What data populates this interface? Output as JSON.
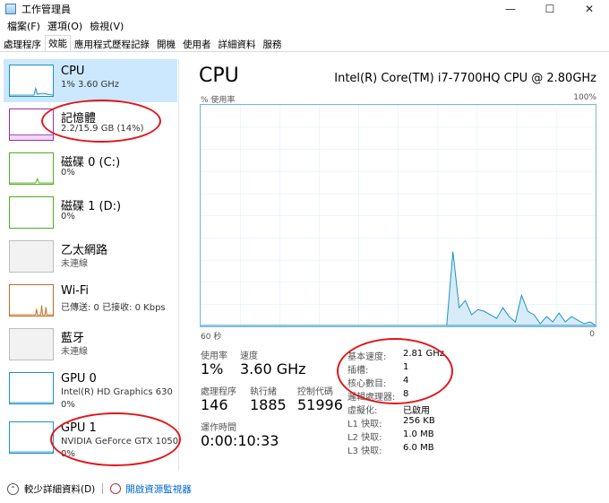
{
  "window": {
    "title": "工作管理員",
    "minimize": "—",
    "maximize": "☐",
    "close": "✕"
  },
  "menu": [
    "檔案(F)",
    "選項(O)",
    "檢視(V)"
  ],
  "tabs": [
    "處理程序",
    "效能",
    "應用程式歷程記錄",
    "開機",
    "使用者",
    "詳細資料",
    "服務"
  ],
  "sidebar": [
    {
      "name": "CPU",
      "sub": "1% 3.60 GHz",
      "color": "#1e90c8"
    },
    {
      "name": "記憶體",
      "sub": "2.2/15.9 GB (14%)",
      "color": "#9b2fae"
    },
    {
      "name": "磁碟 0 (C:)",
      "sub": "0%",
      "color": "#4caf1f"
    },
    {
      "name": "磁碟 1 (D:)",
      "sub": "0%",
      "color": "#4caf1f"
    },
    {
      "name": "乙太網路",
      "sub": "未連線",
      "color": "#9a9a9a"
    },
    {
      "name": "Wi-Fi",
      "sub": "已傳送: 0 已接收: 0 Kbps",
      "color": "#c76a1e"
    },
    {
      "name": "藍牙",
      "sub": "未連線",
      "color": "#9a9a9a"
    },
    {
      "name": "GPU 0",
      "sub": "Intel(R) HD Graphics 630",
      "sub2": "0%",
      "color": "#1e90c8"
    },
    {
      "name": "GPU 1",
      "sub": "NVIDIA GeForce GTX 1050",
      "sub2": "0%",
      "color": "#1e90c8"
    }
  ],
  "main": {
    "title": "CPU",
    "model": "Intel(R) Core(TM) i7-7700HQ CPU @ 2.80GHz",
    "graph_label": "% 使用率",
    "graph_max": "100%",
    "axis_left": "60 秒",
    "axis_right": "0",
    "stats": {
      "usage_label": "使用率",
      "usage": "1%",
      "speed_label": "速度",
      "speed": "3.60 GHz",
      "processes_label": "處理程序",
      "processes": "146",
      "threads_label": "執行緒",
      "threads": "1885",
      "handles_label": "控制代碼",
      "handles": "51996",
      "uptime_label": "運作時間",
      "uptime": "0:00:10:33"
    },
    "specs": [
      {
        "label": "基本速度:",
        "value": "2.81 GHz"
      },
      {
        "label": "插槽:",
        "value": "1"
      },
      {
        "label": "核心數目:",
        "value": "4"
      },
      {
        "label": "邏輯處理器:",
        "value": "8"
      },
      {
        "label": "虛擬化:",
        "value": "已啟用"
      },
      {
        "label": "L1 快取:",
        "value": "256 KB"
      },
      {
        "label": "L2 快取:",
        "value": "1.0 MB"
      },
      {
        "label": "L3 快取:",
        "value": "6.0 MB"
      }
    ]
  },
  "footer": {
    "fewer": "較少詳細資料(D)",
    "resource_monitor": "開啟資源監視器"
  },
  "colors": {
    "accent": "#1e90c8",
    "selected": "#cce8ff",
    "annotation": "#e0161b"
  }
}
